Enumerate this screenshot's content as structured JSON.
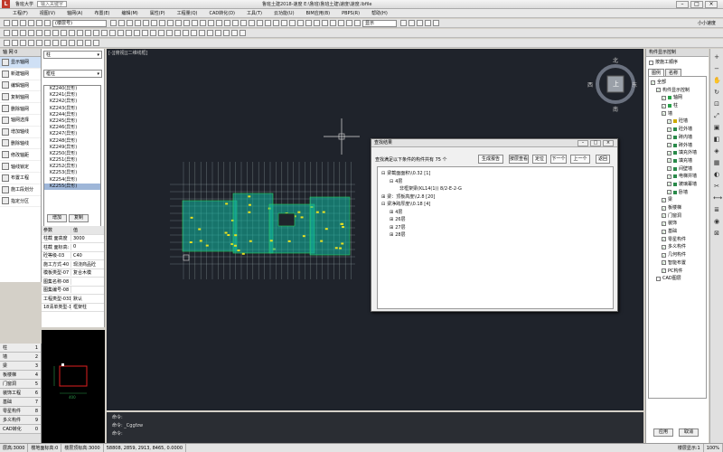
{
  "titlebar": {
    "app_title": "鲁班大学",
    "search_placeholder": "输入关键字",
    "center_title": "鲁班土建2018-速度",
    "file_path": "E:\\鲁班\\鲁班土建\\速度\\速度.lbfile"
  },
  "menu": [
    "工程(F)",
    "视图(V)",
    "轴网(A)",
    "布置(E)",
    "编辑(M)",
    "属性(P)",
    "工程量(Q)",
    "CAD转化(D)",
    "工具(T)",
    "云功能(U)",
    "BIM应用(B)",
    "PBPS(R)",
    "帮助(H)"
  ],
  "toolbar": {
    "floor_dropdown": "(楼层号)",
    "view_dropdown": "显示",
    "user_label": "小小速度"
  },
  "left_tree": {
    "header": "轴 网 0",
    "items": [
      "显示轴网",
      "新建轴网",
      "编辑轴网",
      "复制轴网",
      "删除轴网",
      "轴网选择",
      "增加轴线",
      "删除轴线",
      "修改轴距",
      "轴线锁定",
      "布置工程",
      "施工段划分",
      "指定分区"
    ],
    "selected_index": 0
  },
  "left_bottom": {
    "items": [
      {
        "label": "柱",
        "key": "1"
      },
      {
        "label": "墙",
        "key": "2"
      },
      {
        "label": "梁",
        "key": "3"
      },
      {
        "label": "板楼梯",
        "key": "4"
      },
      {
        "label": "门窗洞",
        "key": "5"
      },
      {
        "label": "装饰工程",
        "key": "6"
      },
      {
        "label": "基础",
        "key": "7"
      },
      {
        "label": "零星构件",
        "key": "8"
      },
      {
        "label": "多义构件",
        "key": "9"
      },
      {
        "label": "CAD转化",
        "key": "0"
      }
    ]
  },
  "comp_panel": {
    "category": "柱",
    "subtype": "框柱",
    "items": [
      "KZ240(异形)",
      "KZ241(异形)",
      "KZ242(异形)",
      "KZ243(异形)",
      "KZ244(异形)",
      "KZ245(异形)",
      "KZ246(异形)",
      "KZ247(异形)",
      "KZ248(异形)",
      "KZ249(异形)",
      "KZ250(异形)",
      "KZ251(异形)",
      "KZ252(异形)",
      "KZ253(异形)",
      "KZ254(异形)",
      "KZ255(异形)"
    ],
    "selected_index": 15,
    "add_button": "增加",
    "copy_button": "复制"
  },
  "props": {
    "header_key": "参数",
    "header_val": "值",
    "rows": [
      {
        "k": "柱截 面高度",
        "v": "3000"
      },
      {
        "k": "柱截 面标高:",
        "v": "0"
      },
      {
        "k": "砼等级-03",
        "v": "C40"
      },
      {
        "k": "施工方式-40",
        "v": "现浇商品砼"
      },
      {
        "k": "模板类型-07",
        "v": "复合木模"
      },
      {
        "k": "图集名称-08",
        "v": ""
      },
      {
        "k": "图集编号-08",
        "v": ""
      },
      {
        "k": "工程类型-031",
        "v": "默认"
      },
      {
        "k": "18清单类型-18",
        "v": "框架柱"
      }
    ]
  },
  "preview": {
    "dim_label": "400"
  },
  "canvas": {
    "tab": "[-][俯视][二维线框]",
    "compass_n": "北",
    "compass_s": "南",
    "compass_e": "东",
    "compass_w": "西",
    "compass_center": "上"
  },
  "command": {
    "line1": "命令:",
    "line2": "命令: _Cggfzw",
    "line3": "命令:"
  },
  "dialog": {
    "title": "查找结果",
    "count_text": "查找满足以下条件的构件共有 75 个",
    "buttons": [
      "生成报告",
      "按层查看",
      "定位",
      "下一个",
      "上一个",
      "返回"
    ],
    "tree": [
      {
        "indent": 0,
        "toggle": "⊟",
        "text": "梁截面面积\\\\0.32 [1]"
      },
      {
        "indent": 1,
        "toggle": "⊟",
        "text": "4层"
      },
      {
        "indent": 2,
        "toggle": "",
        "text": "非框架梁(KL14(1)) 8/2-E-2-G"
      },
      {
        "indent": 0,
        "toggle": "⊞",
        "text": "梁：顶板高度\\\\2.8 [20]"
      },
      {
        "indent": 0,
        "toggle": "⊟",
        "text": "梁净跨厚度\\\\0.18 [4]"
      },
      {
        "indent": 1,
        "toggle": "⊞",
        "text": "4层"
      },
      {
        "indent": 1,
        "toggle": "⊞",
        "text": "26层"
      },
      {
        "indent": 1,
        "toggle": "⊞",
        "text": "27层"
      },
      {
        "indent": 1,
        "toggle": "⊞",
        "text": "28层"
      }
    ]
  },
  "right_panel": {
    "header": "构件显示控制",
    "apply_label": "按施工顺序",
    "tabs": [
      "图例",
      "名称"
    ],
    "layers": [
      {
        "indent": 0,
        "label": "全部",
        "checked": true,
        "color": ""
      },
      {
        "indent": 1,
        "label": "构件显示控制",
        "checked": true,
        "color": ""
      },
      {
        "indent": 2,
        "label": "轴网",
        "checked": true,
        "color": "#2aa14a"
      },
      {
        "indent": 2,
        "label": "柱",
        "checked": true,
        "color": "#2aa14a"
      },
      {
        "indent": 2,
        "label": "墙",
        "checked": true,
        "color": ""
      },
      {
        "indent": 3,
        "label": "砼墙",
        "checked": true,
        "color": "#ccaa00"
      },
      {
        "indent": 3,
        "label": "砼外墙",
        "checked": true,
        "color": "#2a8a4a"
      },
      {
        "indent": 3,
        "label": "砖内墙",
        "checked": true,
        "color": "#2a8a4a"
      },
      {
        "indent": 3,
        "label": "砖外墙",
        "checked": true,
        "color": "#2a8a4a"
      },
      {
        "indent": 3,
        "label": "填充外墙",
        "checked": true,
        "color": "#2a8a4a"
      },
      {
        "indent": 3,
        "label": "填充墙",
        "checked": true,
        "color": "#2a8a4a"
      },
      {
        "indent": 3,
        "label": "间壁墙",
        "checked": true,
        "color": "#2a8a4a"
      },
      {
        "indent": 3,
        "label": "电梯井墙",
        "checked": true,
        "color": "#2a8a4a"
      },
      {
        "indent": 3,
        "label": "玻璃幕墙",
        "checked": true,
        "color": "#2a8a4a"
      },
      {
        "indent": 3,
        "label": "卧墙",
        "checked": true,
        "color": "#2a8a4a"
      },
      {
        "indent": 2,
        "label": "梁",
        "checked": true,
        "color": ""
      },
      {
        "indent": 2,
        "label": "板楼梯",
        "checked": true,
        "color": ""
      },
      {
        "indent": 2,
        "label": "门窗洞",
        "checked": true,
        "color": ""
      },
      {
        "indent": 2,
        "label": "装饰",
        "checked": true,
        "color": ""
      },
      {
        "indent": 2,
        "label": "基础",
        "checked": true,
        "color": ""
      },
      {
        "indent": 2,
        "label": "零星构件",
        "checked": true,
        "color": ""
      },
      {
        "indent": 2,
        "label": "多义构件",
        "checked": true,
        "color": ""
      },
      {
        "indent": 2,
        "label": "几何构件",
        "checked": true,
        "color": ""
      },
      {
        "indent": 2,
        "label": "智能布置",
        "checked": true,
        "color": ""
      },
      {
        "indent": 2,
        "label": "PC构件",
        "checked": true,
        "color": ""
      },
      {
        "indent": 1,
        "label": "CAD图层",
        "checked": false,
        "color": ""
      }
    ],
    "apply_button": "应用",
    "cancel_button": "取消"
  },
  "status": {
    "floor_height": "层高:3000",
    "elev": "楼地面标高:0",
    "bottom_elev": "楼层顶标高:3000",
    "coords": "58808, 2859, 2913, 8465, 0.0000",
    "mode": "楼层显示:1",
    "zoom": "100%"
  }
}
